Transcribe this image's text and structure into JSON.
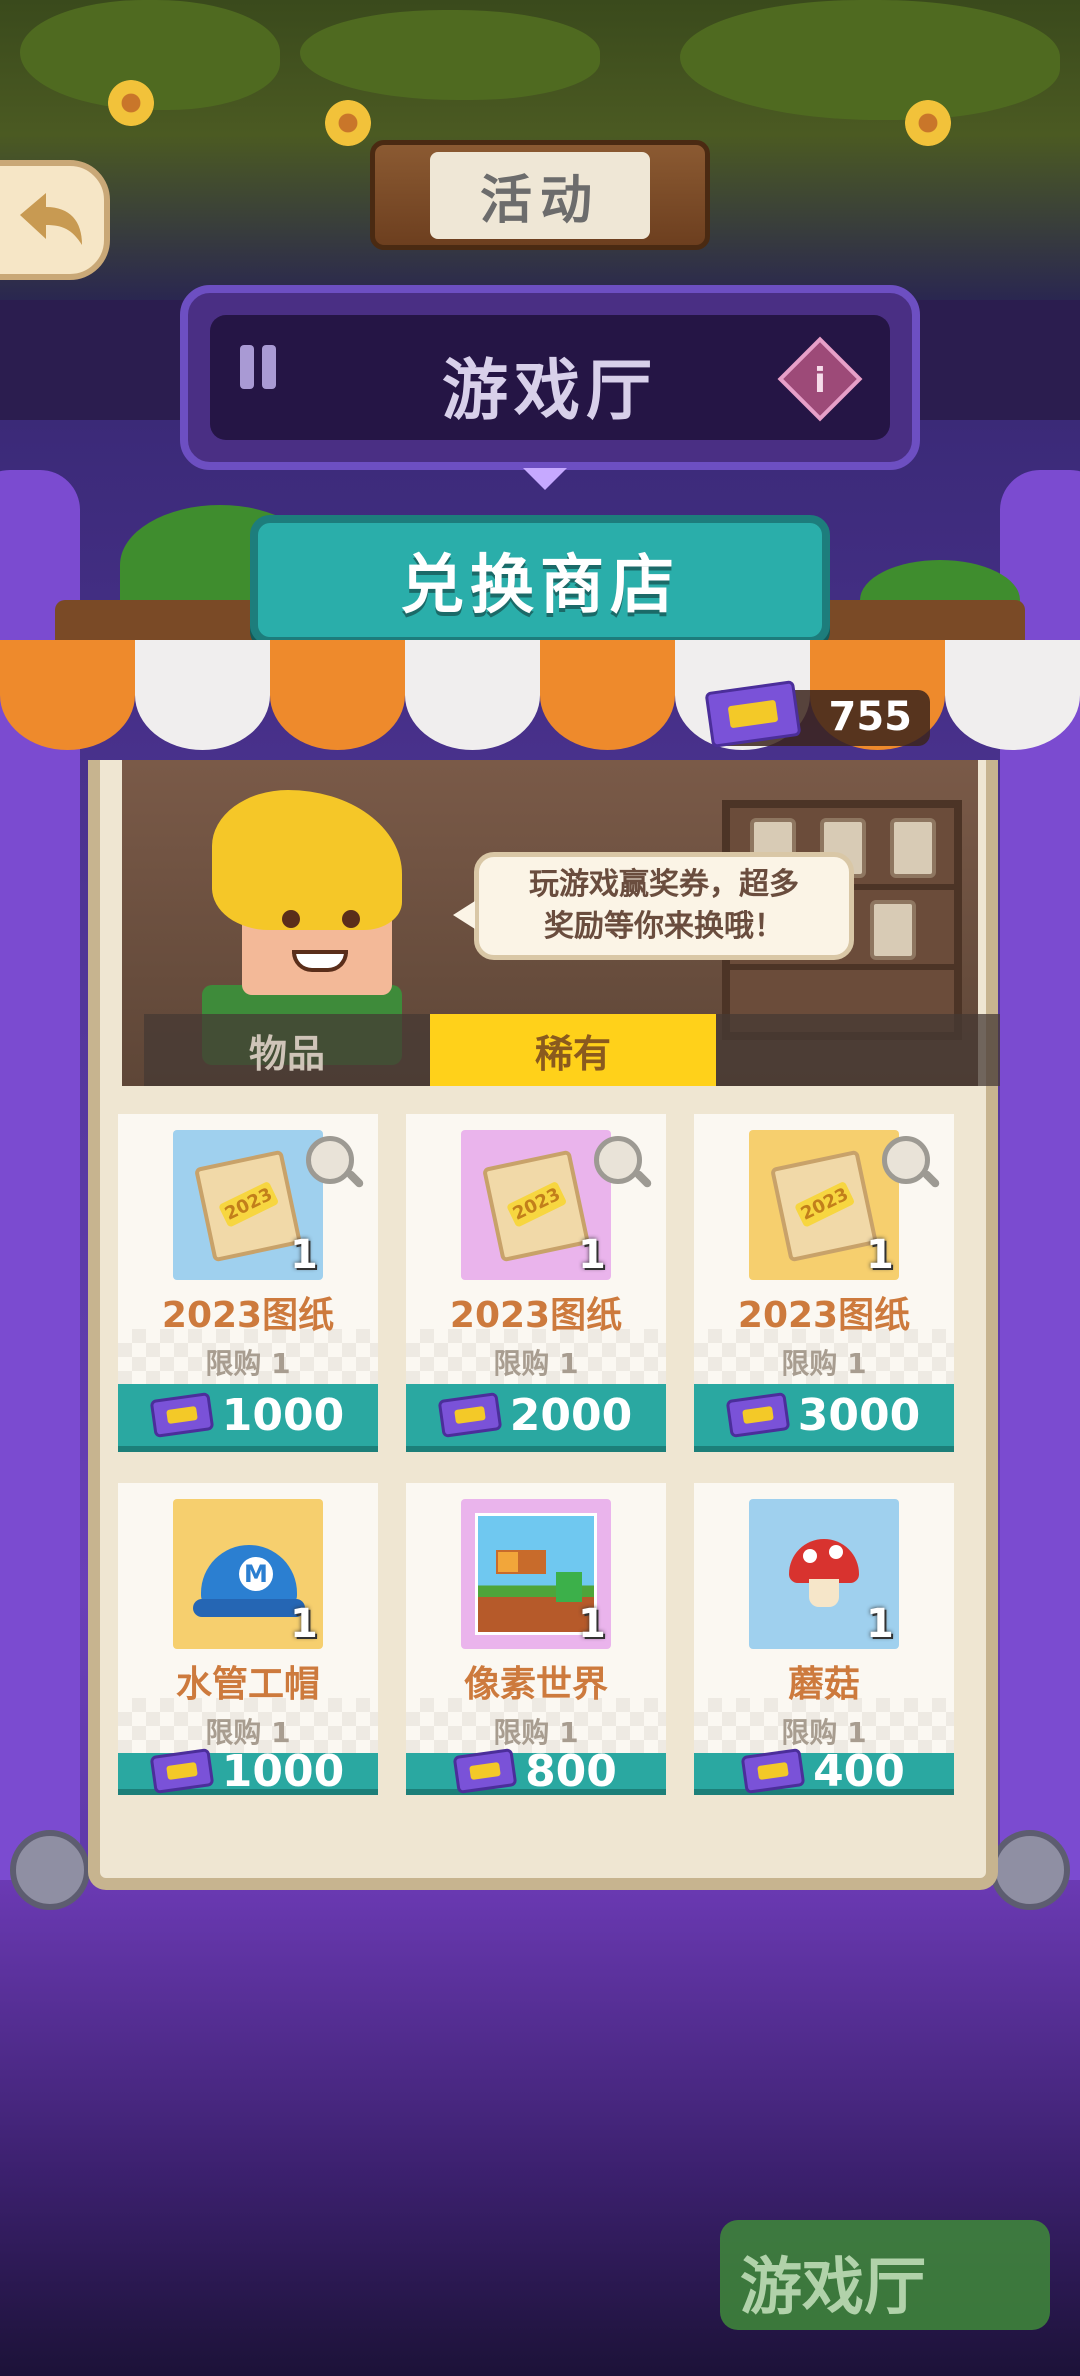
{
  "header": {
    "activity_label": "活动",
    "hall_title": "游戏厅"
  },
  "shop": {
    "title": "兑换商店",
    "ticket_balance": "755",
    "speech_line1": "玩游戏赢奖券，超多",
    "speech_line2": "奖励等你来换哦！",
    "tabs": [
      {
        "label": "物品",
        "selected": false
      },
      {
        "label": "稀有",
        "selected": true
      }
    ],
    "items": [
      {
        "name": "2023图纸",
        "qty": "1",
        "limit": "限购 1",
        "price": "1000",
        "icon": "blueprint-icon",
        "bg": "#9fd0ee"
      },
      {
        "name": "2023图纸",
        "qty": "1",
        "limit": "限购 1",
        "price": "2000",
        "icon": "blueprint-icon",
        "bg": "#eab4ec"
      },
      {
        "name": "2023图纸",
        "qty": "1",
        "limit": "限购 1",
        "price": "3000",
        "icon": "blueprint-icon",
        "bg": "#f6cf6e"
      },
      {
        "name": "水管工帽",
        "qty": "1",
        "limit": "限购 1",
        "price": "1000",
        "icon": "plumber-cap-icon",
        "bg": "#f6cf6e"
      },
      {
        "name": "像素世界",
        "qty": "1",
        "limit": "限购 1",
        "price": "800",
        "icon": "pixel-world-icon",
        "bg": "#eab4ec"
      },
      {
        "name": "蘑菇",
        "qty": "1",
        "limit": "限购 1",
        "price": "400",
        "icon": "mushroom-icon",
        "bg": "#9fd0ee"
      }
    ]
  },
  "background": {
    "sign_text": "游戏厅"
  },
  "colors": {
    "accent_teal": "#2aa8a1",
    "tab_active": "#ffd11a",
    "item_name": "#cd7a3d"
  }
}
